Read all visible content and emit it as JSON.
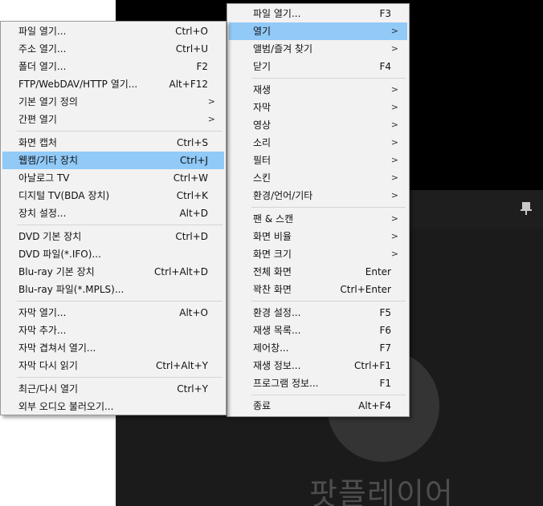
{
  "main_menu": {
    "items": [
      {
        "label": "파일 열기...",
        "shortcut": "F3",
        "submenu": false
      },
      {
        "label": "열기",
        "shortcut": "",
        "submenu": true,
        "highlighted": true
      },
      {
        "label": "앨범/즐겨 찾기",
        "shortcut": "",
        "submenu": true
      },
      {
        "label": "닫기",
        "shortcut": "F4",
        "submenu": false
      },
      {
        "label": "재생",
        "shortcut": "",
        "submenu": true
      },
      {
        "label": "자막",
        "shortcut": "",
        "submenu": true
      },
      {
        "label": "영상",
        "shortcut": "",
        "submenu": true
      },
      {
        "label": "소리",
        "shortcut": "",
        "submenu": true
      },
      {
        "label": "필터",
        "shortcut": "",
        "submenu": true
      },
      {
        "label": "스킨",
        "shortcut": "",
        "submenu": true
      },
      {
        "label": "환경/언어/기타",
        "shortcut": "",
        "submenu": true
      },
      {
        "label": "팬 & 스캔",
        "shortcut": "",
        "submenu": true
      },
      {
        "label": "화면 비율",
        "shortcut": "",
        "submenu": true
      },
      {
        "label": "화면 크기",
        "shortcut": "",
        "submenu": true
      },
      {
        "label": "전체 화면",
        "shortcut": "Enter",
        "submenu": false
      },
      {
        "label": "꽉찬 화면",
        "shortcut": "Ctrl+Enter",
        "submenu": false
      },
      {
        "label": "환경 설정...",
        "shortcut": "F5",
        "submenu": false
      },
      {
        "label": "재생 목록...",
        "shortcut": "F6",
        "submenu": false
      },
      {
        "label": "제어창...",
        "shortcut": "F7",
        "submenu": false
      },
      {
        "label": "재생 정보...",
        "shortcut": "Ctrl+F1",
        "submenu": false
      },
      {
        "label": "프로그램 정보...",
        "shortcut": "F1",
        "submenu": false
      },
      {
        "label": "종료",
        "shortcut": "Alt+F4",
        "submenu": false
      }
    ]
  },
  "open_submenu": {
    "items": [
      {
        "label": "파일 열기...",
        "shortcut": "Ctrl+O",
        "submenu": false
      },
      {
        "label": "주소 열기...",
        "shortcut": "Ctrl+U",
        "submenu": false
      },
      {
        "label": "폴더 열기...",
        "shortcut": "F2",
        "submenu": false
      },
      {
        "label": "FTP/WebDAV/HTTP 열기...",
        "shortcut": "Alt+F12",
        "submenu": false
      },
      {
        "label": "기본 열기 정의",
        "shortcut": "",
        "submenu": true
      },
      {
        "label": "간편 열기",
        "shortcut": "",
        "submenu": true
      },
      {
        "label": "화면 캡처",
        "shortcut": "Ctrl+S",
        "submenu": false
      },
      {
        "label": "웹캠/기타 장치",
        "shortcut": "Ctrl+J",
        "submenu": false,
        "highlighted": true
      },
      {
        "label": "아날로그 TV",
        "shortcut": "Ctrl+W",
        "submenu": false
      },
      {
        "label": "디지털 TV(BDA 장치)",
        "shortcut": "Ctrl+K",
        "submenu": false
      },
      {
        "label": "장치 설정...",
        "shortcut": "Alt+D",
        "submenu": false
      },
      {
        "label": "DVD 기본 장치",
        "shortcut": "Ctrl+D",
        "submenu": false
      },
      {
        "label": "DVD 파일(*.IFO)...",
        "shortcut": "",
        "submenu": false
      },
      {
        "label": "Blu-ray 기본 장치",
        "shortcut": "Ctrl+Alt+D",
        "submenu": false
      },
      {
        "label": "Blu-ray 파일(*.MPLS)...",
        "shortcut": "",
        "submenu": false
      },
      {
        "label": "자막 열기...",
        "shortcut": "Alt+O",
        "submenu": false
      },
      {
        "label": "자막 추가...",
        "shortcut": "",
        "submenu": false
      },
      {
        "label": "자막 겹쳐서 열기...",
        "shortcut": "",
        "submenu": false
      },
      {
        "label": "자막 다시 읽기",
        "shortcut": "Ctrl+Alt+Y",
        "submenu": false
      },
      {
        "label": "최근/다시 열기",
        "shortcut": "Ctrl+Y",
        "submenu": false
      },
      {
        "label": "외부 오디오 불러오기...",
        "shortcut": "",
        "submenu": false
      }
    ]
  },
  "player": {
    "logo_text": "팟플레이어",
    "pin_icon": "pin-icon"
  },
  "colors": {
    "menu_bg": "#f2f2f2",
    "highlight": "#91c9f7",
    "player_bg": "#1b1b1b"
  }
}
